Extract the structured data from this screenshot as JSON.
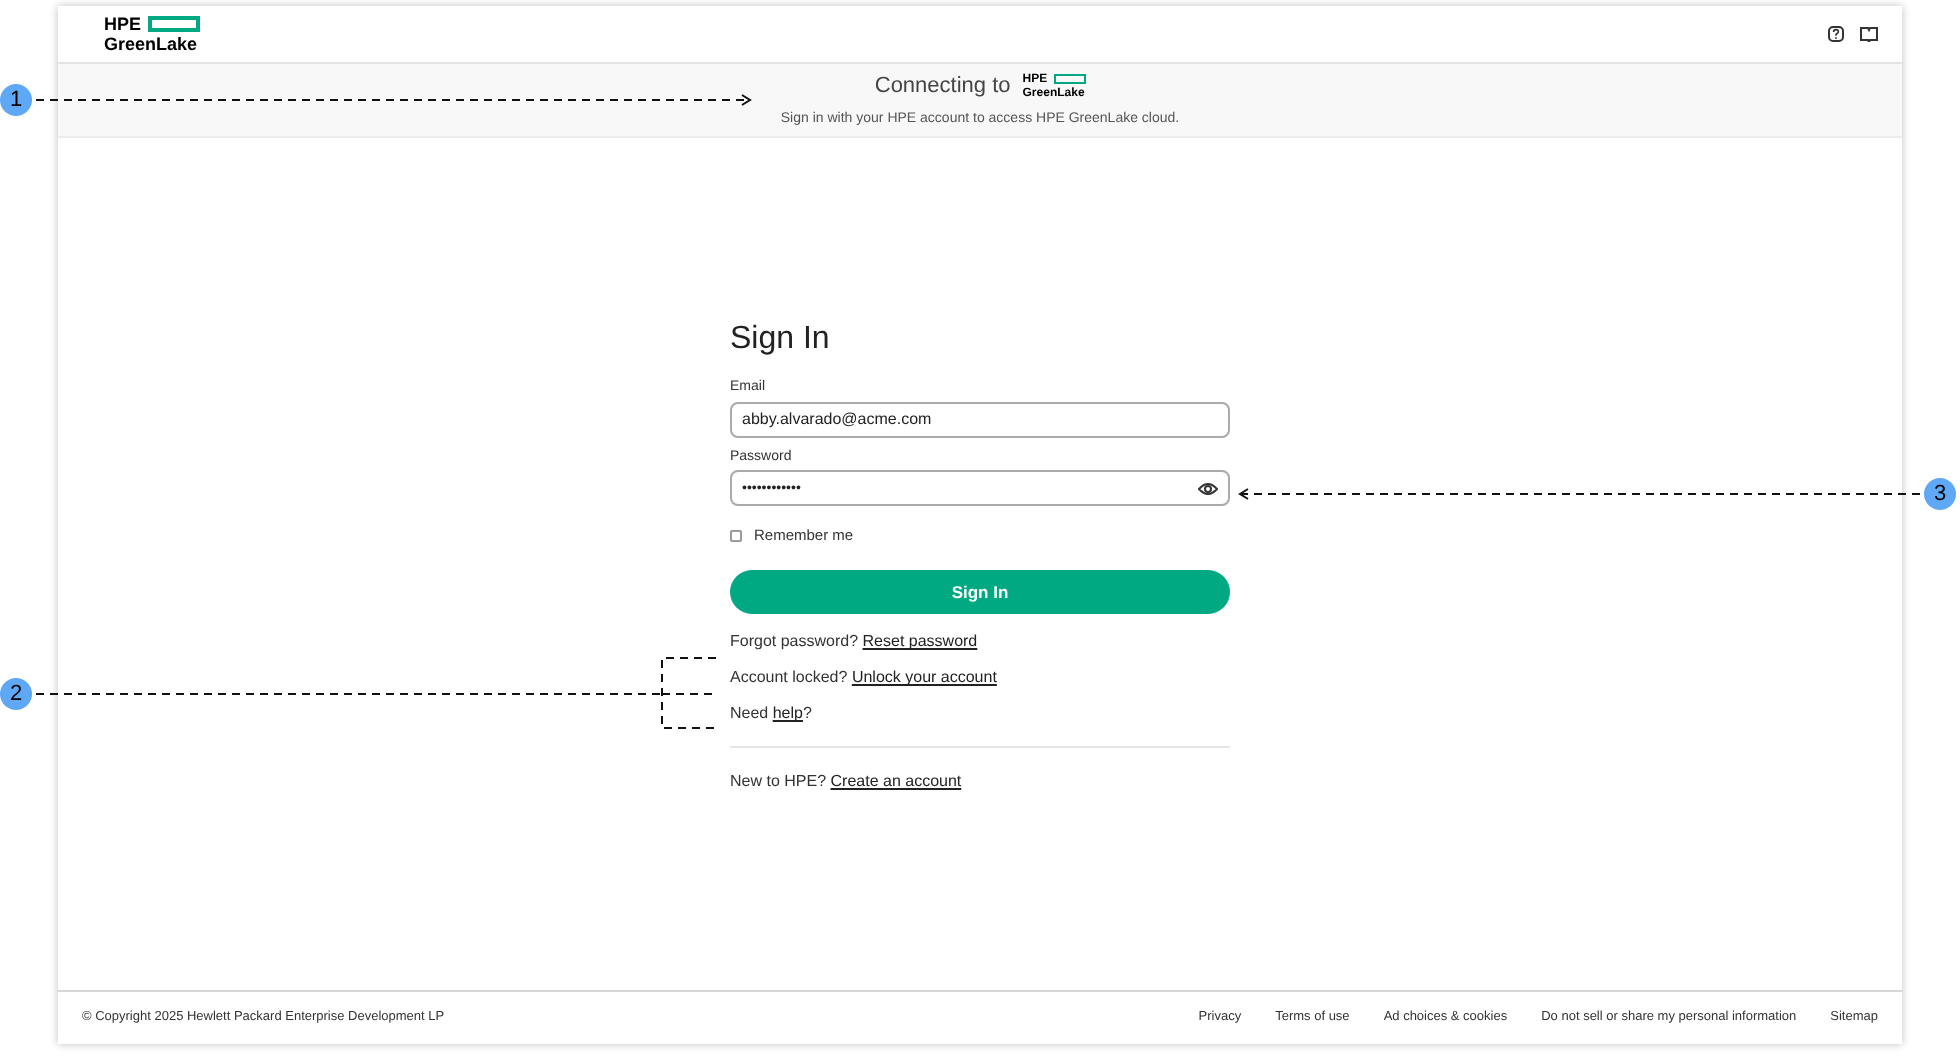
{
  "header": {
    "logo_top": "HPE",
    "logo_bottom": "GreenLake"
  },
  "banner": {
    "title": "Connecting to",
    "logo_top": "HPE",
    "logo_bottom": "GreenLake",
    "subtitle": "Sign in with your HPE account to access HPE GreenLake cloud."
  },
  "form": {
    "title": "Sign In",
    "email": {
      "label": "Email",
      "value": "abby.alvarado@acme.com"
    },
    "password": {
      "label": "Password",
      "value": "••••••••••••"
    },
    "remember": {
      "label": "Remember me",
      "checked": false
    },
    "submit": "Sign In",
    "help_lines": [
      {
        "text": "Forgot password?",
        "link": "Reset password"
      },
      {
        "text": "Account locked?",
        "link": "Unlock your account"
      },
      {
        "text": "Need",
        "link": "help",
        "after": "?"
      }
    ],
    "signup": {
      "text": "New to HPE?",
      "link": "Create an account"
    }
  },
  "footer": {
    "copyright": "© Copyright 2025 Hewlett Packard Enterprise Development LP",
    "links": [
      "Privacy",
      "Terms of use",
      "Ad choices & cookies",
      "Do not sell or share my personal information",
      "Sitemap"
    ]
  },
  "callouts": [
    "1",
    "2",
    "3"
  ]
}
